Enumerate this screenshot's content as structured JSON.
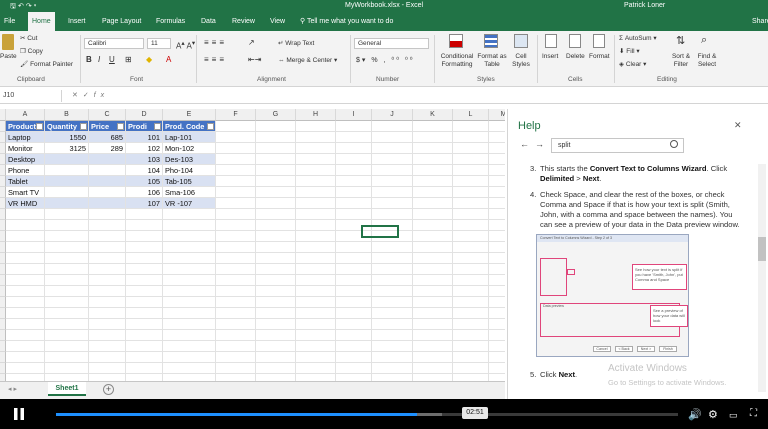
{
  "titlebar": {
    "document": "MyWorkbook.xlsx - Excel",
    "user": "Patrick Loner"
  },
  "tabs": [
    "File",
    "Home",
    "Insert",
    "Page Layout",
    "Formulas",
    "Data",
    "Review",
    "View"
  ],
  "tell_me": "Tell me what you want to do",
  "share": "Share",
  "ribbon": {
    "clipboard": {
      "paste": "Paste",
      "cut": "Cut",
      "copy": "Copy",
      "format_painter": "Format Painter",
      "label": "Clipboard"
    },
    "font": {
      "name": "Calibri",
      "size": "11",
      "label": "Font"
    },
    "alignment": {
      "wrap": "Wrap Text",
      "merge": "Merge & Center",
      "label": "Alignment"
    },
    "number": {
      "format": "General",
      "label": "Number"
    },
    "styles": {
      "conditional": "Conditional Formatting",
      "format_table": "Format as Table",
      "cell_styles": "Cell Styles",
      "label": "Styles"
    },
    "cells": {
      "insert": "Insert",
      "delete": "Delete",
      "format": "Format",
      "label": "Cells"
    },
    "editing": {
      "autosum": "AutoSum",
      "fill": "Fill",
      "clear": "Clear",
      "sort": "Sort & Filter",
      "find": "Find & Select",
      "label": "Editing"
    }
  },
  "formula_bar": {
    "name_box": "J10",
    "fx": "fx"
  },
  "columns": [
    "A",
    "B",
    "C",
    "D",
    "E",
    "F",
    "G",
    "H",
    "I",
    "J",
    "K",
    "L",
    "M"
  ],
  "table": {
    "headers": [
      "Product",
      "Quantity",
      "Price",
      "Prodi",
      "Prod. Code"
    ],
    "rows": [
      [
        "Laptop",
        "1550",
        "685",
        "101",
        "Lap-101"
      ],
      [
        "Monitor",
        "3125",
        "289",
        "102",
        "Mon-102"
      ],
      [
        "Desktop",
        "",
        "",
        "103",
        "Des-103"
      ],
      [
        "Phone",
        "",
        "",
        "104",
        "Pho-104"
      ],
      [
        "Tablet",
        "",
        "",
        "105",
        "Tab-105"
      ],
      [
        "Smart TV",
        "",
        "",
        "106",
        "Sma-106"
      ],
      [
        "VR HMD",
        "",
        "",
        "107",
        "VR -107"
      ]
    ]
  },
  "sheet_tab": "Sheet1",
  "help": {
    "title": "Help",
    "search_value": "split",
    "step3_num": "3.",
    "step3_a": "This starts the ",
    "step3_b": "Convert Text to Columns Wizard",
    "step3_c": ". Click ",
    "step3_d": "Delimited",
    "step3_e": " > ",
    "step3_f": "Next",
    "step3_g": ".",
    "step4_num": "4.",
    "step4_text": "Check Space, and clear the rest of the boxes, or check Comma and Space if that is how your text is split (Smith, John, with a comma and space between the names). You can see a preview of your data in the Data preview window.",
    "step5_num": "5.",
    "step5_a": "Click ",
    "step5_b": "Next",
    "step5_c": ".",
    "wizard_title": "Convert Text to Columns Wizard - Step 2 of 3",
    "callout1": "See how your text is split if you have 'Smith, John', put Comma and Space",
    "callout2": "See a preview of how your data will look",
    "data_preview": "Data preview",
    "buttons": [
      "Cancel",
      "< Back",
      "Next >",
      "Finish"
    ],
    "activate": "Activate Windows",
    "activate_sub": "Go to Settings to activate Windows."
  },
  "video": {
    "time_tooltip": "02:51",
    "progress_fraction": 0.58,
    "buffered_fraction": 0.62
  }
}
